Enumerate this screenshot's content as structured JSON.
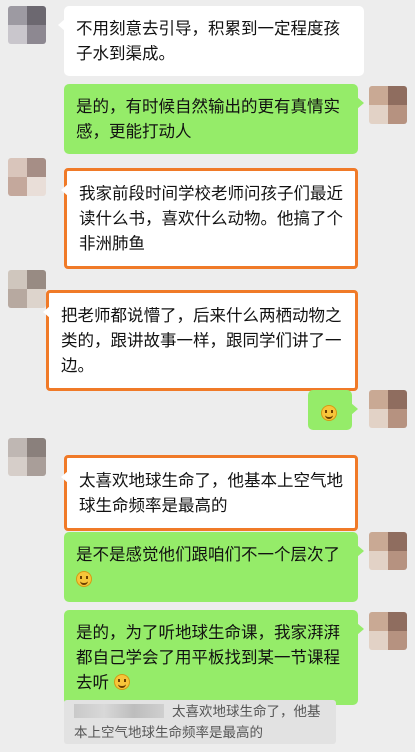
{
  "messages": [
    {
      "text": "不用刻意去引导，积累到一定程度孩子水到渠成。"
    },
    {
      "text": "是的，有时候自然输出的更有真情实感，更能打动人"
    },
    {
      "text": "我家前段时间学校老师问孩子们最近读什么书，喜欢什么动物。他搞了个非洲肺鱼"
    },
    {
      "text": "把老师都说懵了，后来什么两栖动物之类的，跟讲故事一样，跟同学们讲了一边。"
    },
    {
      "emoji": "smile-emoji"
    },
    {
      "text": "太喜欢地球生命了，他基本上空气地球生命频率是最高的"
    },
    {
      "text": "是不是感觉他们跟咱们不一个层次了"
    },
    {
      "text": "是的，为了听地球生命课，我家湃湃都自己学会了用平板找到某一节课程去听"
    }
  ],
  "quote": {
    "text": "太喜欢地球生命了，他基本上空气地球生命频率是最高的"
  },
  "colors": {
    "background": "#ededed",
    "sent_bubble": "#95ec69",
    "received_bubble": "#ffffff",
    "highlight": "#f07a28"
  }
}
